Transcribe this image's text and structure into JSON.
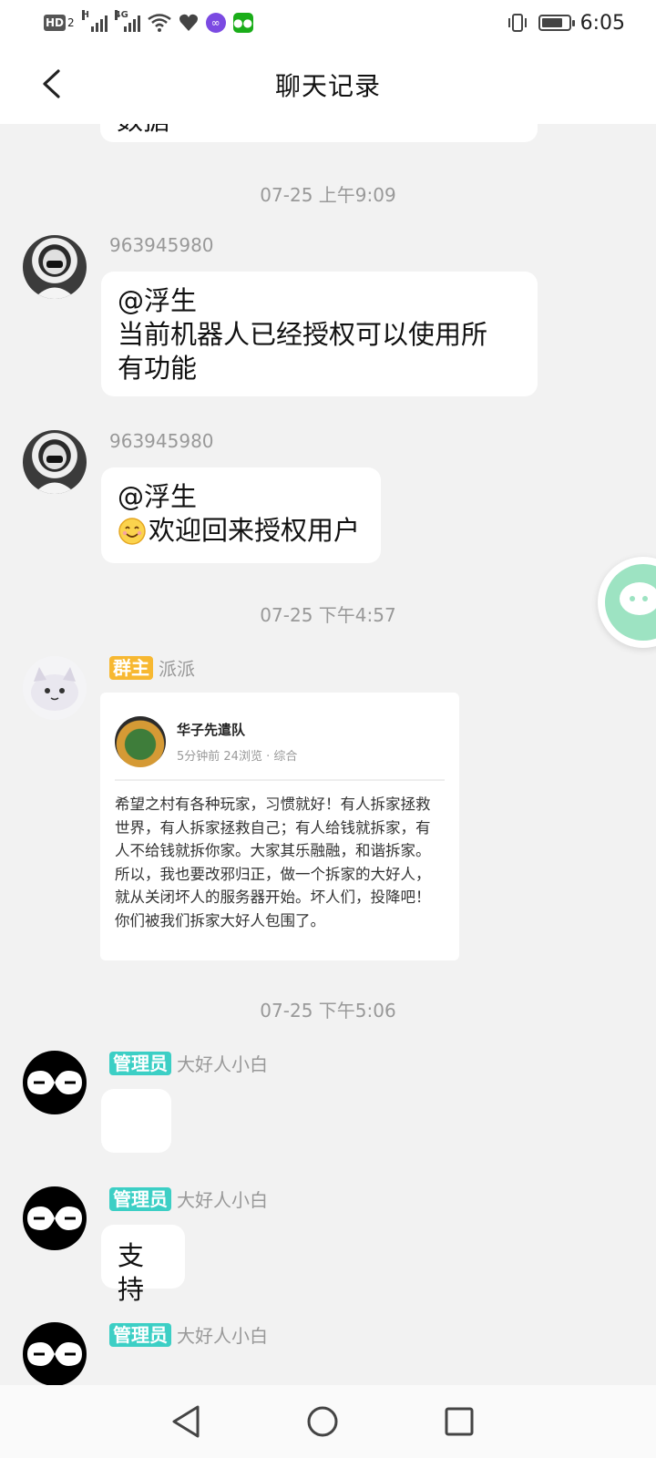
{
  "status_bar": {
    "time": "6:05",
    "network_type": "4G",
    "hd_label": "HD",
    "hd_sub": "2",
    "signal_label": "H"
  },
  "header": {
    "title": "聊天记录",
    "back_icon": "chevron-left-icon"
  },
  "top_partial_message": "数据",
  "timestamps": [
    "07-25 上午9:09",
    "07-25 下午4:57",
    "07-25 下午5:06"
  ],
  "messages": [
    {
      "sender": "963945980",
      "lines": [
        "@浮生",
        "当前机器人已经授权可以使用所",
        "有功能"
      ]
    },
    {
      "sender": "963945980",
      "lines": [
        "@浮生",
        "欢迎回来授权用户"
      ],
      "emoji": "smile-emoji"
    },
    {
      "sender": "派派",
      "role_badge": "群主",
      "shared_post": {
        "author": "华子先遣队",
        "meta": "5分钟前  24浏览 · 综合",
        "body": "希望之村有各种玩家，习惯就好！有人拆家拯救世界，有人拆家拯救自己；有人给钱就拆家，有人不给钱就拆你家。大家其乐融融，和谐拆家。所以，我也要改邪归正，做一个拆家的大好人，就从关闭坏人的服务器开始。坏人们，投降吧！你们被我们拆家大好人包围了。"
      }
    },
    {
      "sender": "大好人小白",
      "role_badge": "管理员",
      "text": ""
    },
    {
      "sender": "大好人小白",
      "role_badge": "管理员",
      "text": "支持"
    },
    {
      "sender": "大好人小白",
      "role_badge": "管理员",
      "text": ""
    }
  ],
  "colors": {
    "owner_badge": "#f7b831",
    "admin_badge": "#3ccfc5",
    "background": "#f2f2f2",
    "float_button": "#9de3c2"
  },
  "system_nav": {
    "back_icon": "triangle-back-icon",
    "home_icon": "circle-home-icon",
    "recents_icon": "square-recents-icon"
  }
}
